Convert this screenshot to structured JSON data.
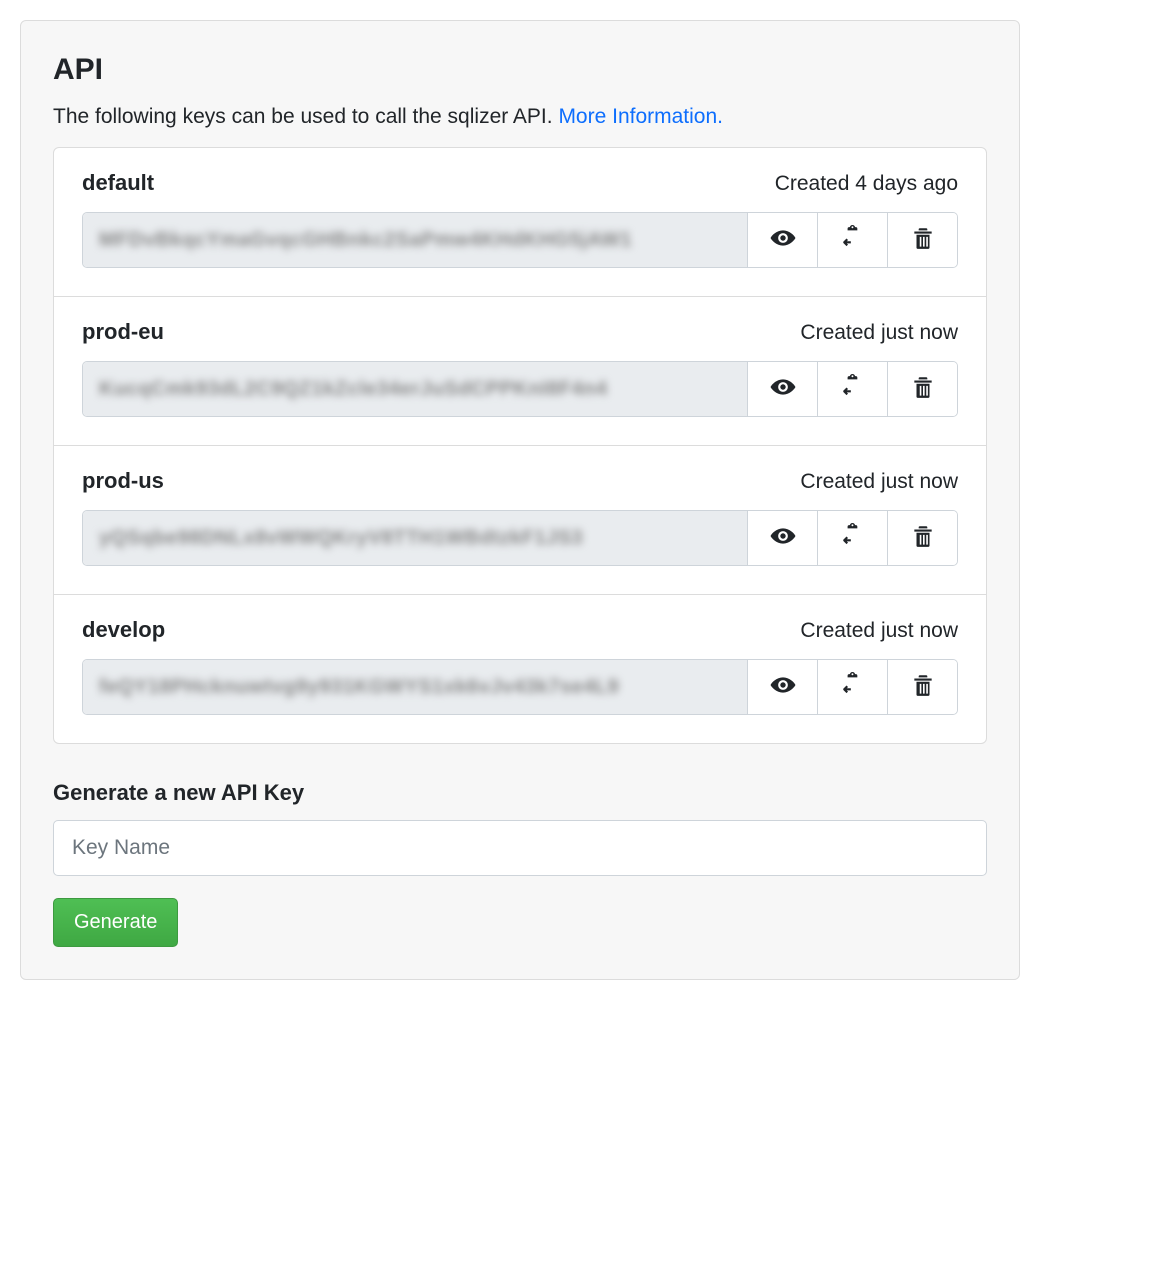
{
  "section": {
    "title": "API",
    "description": "The following keys can be used to call the sqlizer API. ",
    "more_info_label": "More Information."
  },
  "keys": [
    {
      "name": "default",
      "created": "Created 4 days ago",
      "masked_value": "MFDvBkqcYmaGvqcGHBnkc2SaPmw4KHdKHG5jAW1"
    },
    {
      "name": "prod-eu",
      "created": "Created just now",
      "masked_value": "KucqCmk93dL2C9QZ1kZcle34erJuSdCPPKnI8F4n4"
    },
    {
      "name": "prod-us",
      "created": "Created just now",
      "masked_value": "yQSqbe98DNLx8vWWQKryV8TTH1WBdtzkF1JS3"
    },
    {
      "name": "develop",
      "created": "Created just now",
      "masked_value": "feQY18PHcknuwtvg9y931KGWYS1xk6vJv43k7se4L9"
    }
  ],
  "generate": {
    "heading": "Generate a new API Key",
    "placeholder": "Key Name",
    "button_label": "Generate"
  },
  "icons": {
    "reveal": "eye-icon",
    "copy": "clipboard-icon",
    "delete": "trash-icon"
  }
}
